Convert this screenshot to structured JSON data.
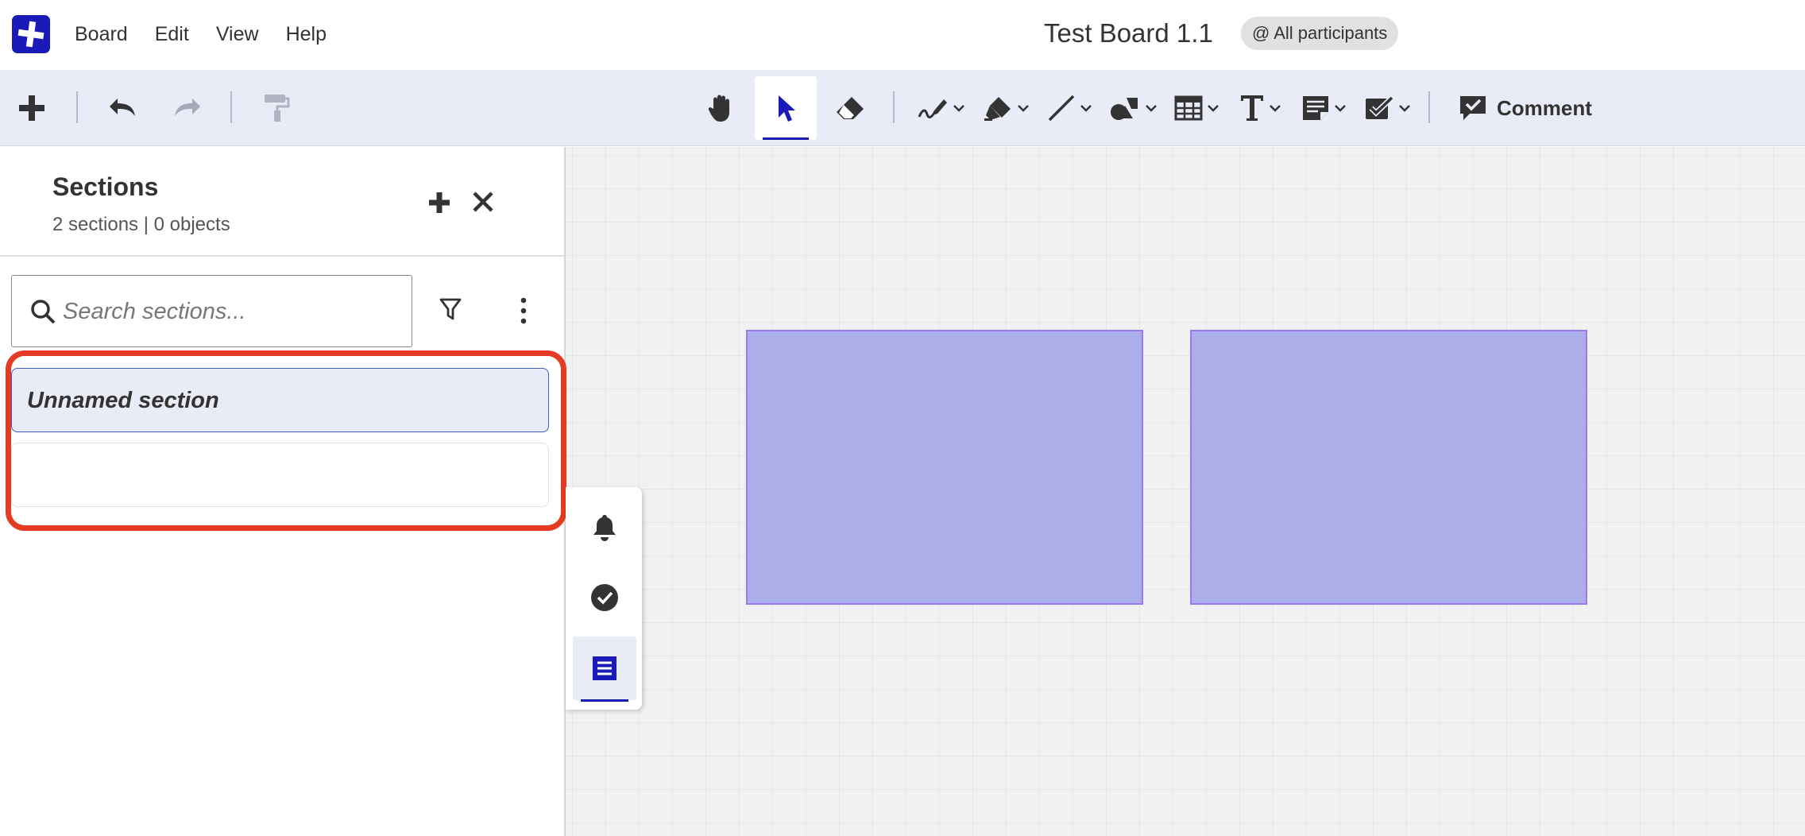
{
  "titlebar": {
    "logo_icon": "plus-cross-logo-icon",
    "menu": [
      "Board",
      "Edit",
      "View",
      "Help"
    ],
    "board_title": "Test Board 1.1",
    "participants": "@ All participants"
  },
  "toolbar": {
    "tools": [
      "add",
      "undo",
      "redo",
      "format-painter",
      "hand",
      "select",
      "eraser",
      "pen",
      "highlighter",
      "line",
      "shapes",
      "table",
      "text",
      "sticky-note",
      "checklist"
    ],
    "active_tool": "select",
    "comment_label": "Comment"
  },
  "sidebar": {
    "title": "Sections",
    "summary": "2 sections | 0 objects",
    "search_placeholder": "Search sections...",
    "search_value": "",
    "sections": [
      {
        "label": "Unnamed section",
        "selected": true
      },
      {
        "label": "",
        "selected": false
      }
    ]
  },
  "rail": {
    "items": [
      "notifications",
      "tasks",
      "sections"
    ],
    "active": "sections"
  },
  "colors": {
    "brand": "#1a1ab8",
    "toolbar_bg": "#e9ebf7",
    "section_fill": "#abaee8",
    "section_border": "#9b79f3",
    "highlight": "#e53a24"
  }
}
